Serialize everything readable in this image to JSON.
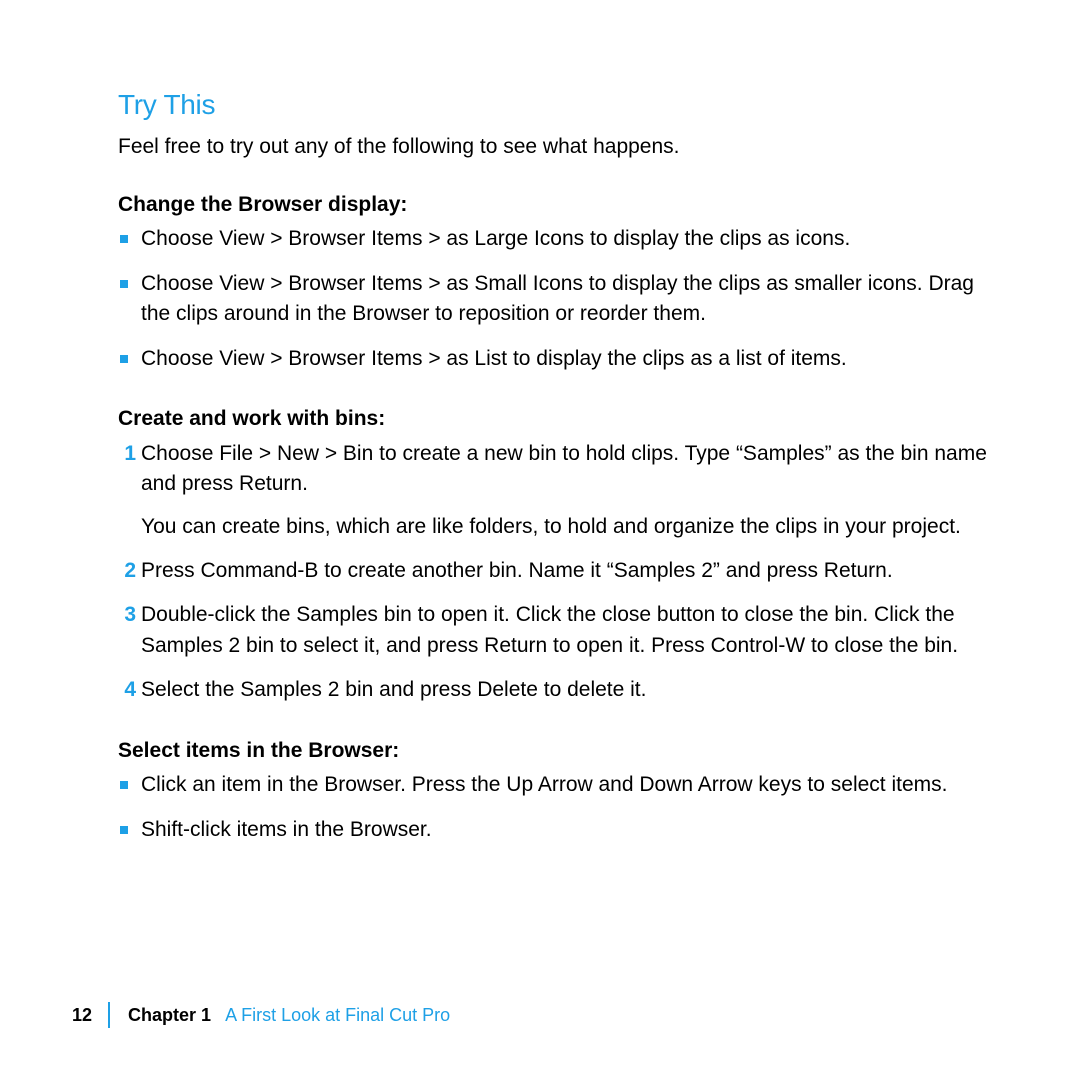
{
  "heading": "Try This",
  "intro": "Feel free to try out any of the following to see what happens.",
  "sections": [
    {
      "label": "Change the Browser display:",
      "type": "bullets",
      "items": [
        "Choose View > Browser Items > as Large Icons to display the clips as icons.",
        "Choose View > Browser Items > as Small Icons to display the clips as smaller icons. Drag the clips around in the Browser to reposition or reorder them.",
        "Choose View > Browser Items > as List to display the clips as a list of items."
      ]
    },
    {
      "label": "Create and work with bins:",
      "type": "numbers",
      "items": [
        {
          "text": "Choose File > New > Bin to create a new bin to hold clips. Type “Samples” as the bin name and press Return.",
          "sub": "You can create bins, which are like folders, to hold and organize the clips in your project."
        },
        {
          "text": "Press Command-B to create another bin. Name it “Samples 2” and press Return."
        },
        {
          "text": "Double-click the Samples bin to open it. Click the close button to close the bin. Click the Samples 2 bin to select it, and press Return to open it. Press Control-W to close the bin."
        },
        {
          "text": "Select the Samples 2 bin and press Delete to delete it."
        }
      ]
    },
    {
      "label": "Select items in the Browser:",
      "type": "bullets",
      "items": [
        "Click an item in the Browser. Press the Up Arrow and Down Arrow keys to select items.",
        "Shift-click items in the Browser."
      ]
    }
  ],
  "footer": {
    "page": "12",
    "chapter_label": "Chapter 1",
    "chapter_title": "A First Look at Final Cut Pro"
  }
}
